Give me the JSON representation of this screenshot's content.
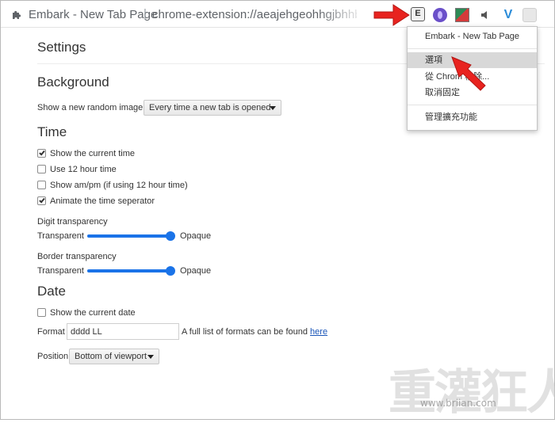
{
  "browser": {
    "tab_title": "Embark - New Tab Page",
    "separator": "|",
    "url": "chrome-extension://aeajehgeohhgjbhhbicilk"
  },
  "extensions": {
    "embark_letter": "E"
  },
  "settings": {
    "heading": "Settings",
    "background": {
      "heading": "Background",
      "random_label": "Show a new random image:",
      "random_value": "Every time a new tab is opened"
    },
    "time": {
      "heading": "Time",
      "options": [
        {
          "label": "Show the current time",
          "checked": true
        },
        {
          "label": "Use 12 hour time",
          "checked": false
        },
        {
          "label": "Show am/pm (if using 12 hour time)",
          "checked": false
        },
        {
          "label": "Animate the time seperator",
          "checked": true
        }
      ],
      "digit_transparency": {
        "label": "Digit transparency",
        "min_label": "Transparent",
        "max_label": "Opaque",
        "value": 1.0
      },
      "border_transparency": {
        "label": "Border transparency",
        "min_label": "Transparent",
        "max_label": "Opaque",
        "value": 1.0
      }
    },
    "date": {
      "heading": "Date",
      "show_date_label": "Show the current date",
      "show_date_checked": false,
      "format_label": "Format",
      "format_value": "dddd LL",
      "format_help": "A full list of formats can be found",
      "format_link": "here",
      "position_label": "Position",
      "position_value": "Bottom of viewport"
    }
  },
  "context_menu": {
    "title": "Embark - New Tab Page",
    "options": "選項",
    "remove": "從 Chrom     移除...",
    "unpin": "取消固定",
    "manage": "管理擴充功能"
  },
  "watermark": {
    "logo_text": "重灌狂人",
    "url": "www.briian.com"
  },
  "colors": {
    "accent": "#1a73e8",
    "annotation_arrow": "#e8231f",
    "menu_highlight": "#d8d8d8"
  }
}
